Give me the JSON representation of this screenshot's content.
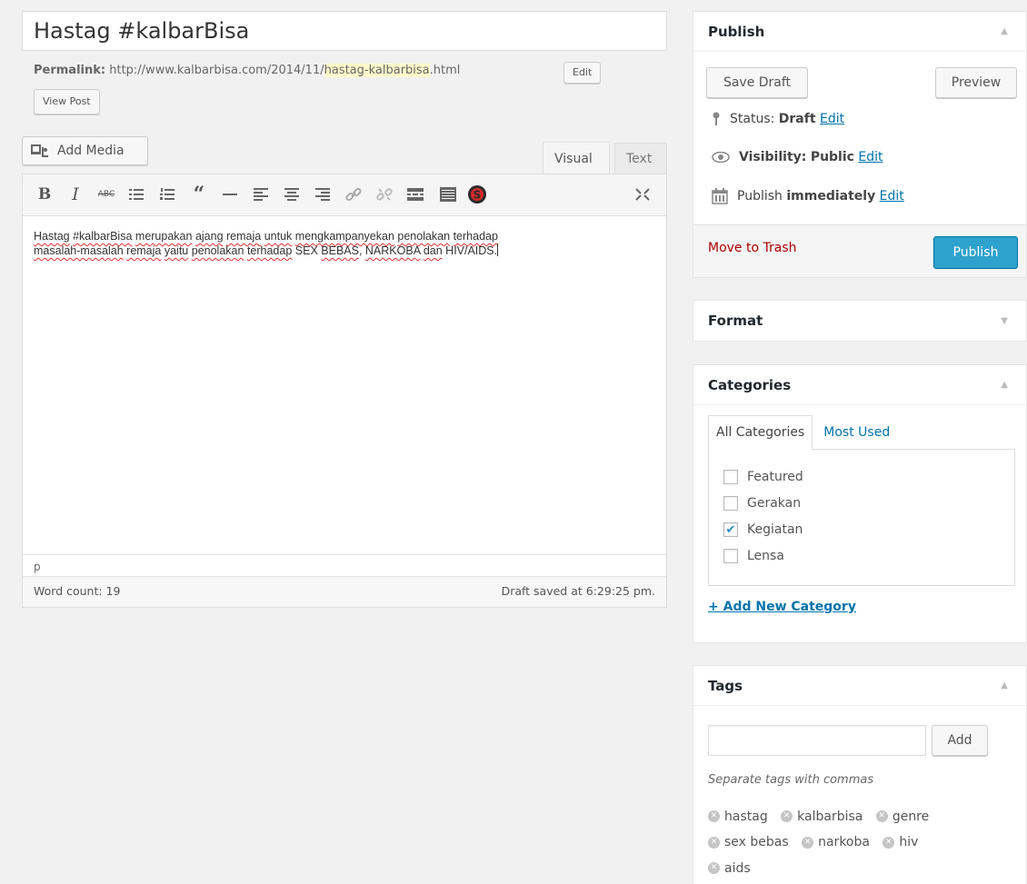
{
  "post": {
    "title": "Hastag #kalbarBisa",
    "permalink_label": "Permalink:",
    "permalink_base": "http://www.kalbarbisa.com/2014/11/",
    "permalink_slug": "hastag-kalbarbisa",
    "permalink_ext": ".html",
    "edit_label": "Edit",
    "view_post_label": "View Post"
  },
  "editor": {
    "add_media_label": "Add Media",
    "tab_visual": "Visual",
    "tab_text": "Text",
    "toolbar_icons": [
      "bold-icon",
      "italic-icon",
      "strikethrough-icon",
      "bullet-list-icon",
      "numbered-list-icon",
      "blockquote-icon",
      "horizontal-rule-icon",
      "align-left-icon",
      "align-center-icon",
      "align-right-icon",
      "insert-link-icon",
      "remove-link-icon",
      "read-more-icon",
      "toolbar-toggle-icon",
      "spellcheck-icon",
      "fullscreen-icon"
    ],
    "content_words": [
      {
        "t": "Hastag",
        "sq": true
      },
      {
        "t": " "
      },
      {
        "t": "#kalbarBisa",
        "sq": true
      },
      {
        "t": " "
      },
      {
        "t": "merupakan",
        "sq": true
      },
      {
        "t": " "
      },
      {
        "t": "ajang",
        "sq": true
      },
      {
        "t": " "
      },
      {
        "t": "remaja",
        "sq": true
      },
      {
        "t": " "
      },
      {
        "t": "untuk",
        "sq": true
      },
      {
        "t": " "
      },
      {
        "t": "mengkampanyekan",
        "sq": true
      },
      {
        "t": " "
      },
      {
        "t": "penolakan",
        "sq": true
      },
      {
        "t": " "
      },
      {
        "t": "terhadap",
        "sq": true
      },
      {
        "t": "\n"
      },
      {
        "t": "masalah-masalah",
        "sq": true
      },
      {
        "t": " "
      },
      {
        "t": "remaja",
        "sq": true
      },
      {
        "t": " "
      },
      {
        "t": "yaitu",
        "sq": true
      },
      {
        "t": " "
      },
      {
        "t": "penolakan",
        "sq": true
      },
      {
        "t": " "
      },
      {
        "t": "terhadap",
        "sq": true
      },
      {
        "t": " SEX "
      },
      {
        "t": "BEBAS",
        "sq": true
      },
      {
        "t": ", "
      },
      {
        "t": "NARKOBA",
        "sq": true
      },
      {
        "t": " "
      },
      {
        "t": "dan",
        "sq": true
      },
      {
        "t": " HIV/AIDS."
      }
    ],
    "path": "p",
    "word_count": "Word count: 19",
    "draft_saved": "Draft saved at 6:29:25 pm."
  },
  "publish": {
    "heading": "Publish",
    "save_draft": "Save Draft",
    "preview": "Preview",
    "status_label": "Status:",
    "status_value": "Draft",
    "visibility_label": "Visibility:",
    "visibility_value": "Public",
    "publish_label": "Publish",
    "publish_value": "immediately",
    "edit_link": "Edit",
    "move_to_trash": "Move to Trash",
    "publish_button": "Publish"
  },
  "format": {
    "heading": "Format"
  },
  "categories": {
    "heading": "Categories",
    "tab_all": "All Categories",
    "tab_most_used": "Most Used",
    "items": [
      {
        "label": "Featured",
        "checked": false
      },
      {
        "label": "Gerakan",
        "checked": false
      },
      {
        "label": "Kegiatan",
        "checked": true
      },
      {
        "label": "Lensa",
        "checked": false
      }
    ],
    "add_new": "+ Add New Category"
  },
  "tags": {
    "heading": "Tags",
    "input_value": "",
    "add_button": "Add",
    "hint": "Separate tags with commas",
    "items": [
      "hastag",
      "kalbarbisa",
      "genre",
      "sex bebas",
      "narkoba",
      "hiv",
      "aids"
    ]
  },
  "colors": {
    "primary": "#2ea2cc",
    "link": "#0073aa",
    "trash": "#aa0000",
    "slug_highlight": "#fffbcc"
  }
}
